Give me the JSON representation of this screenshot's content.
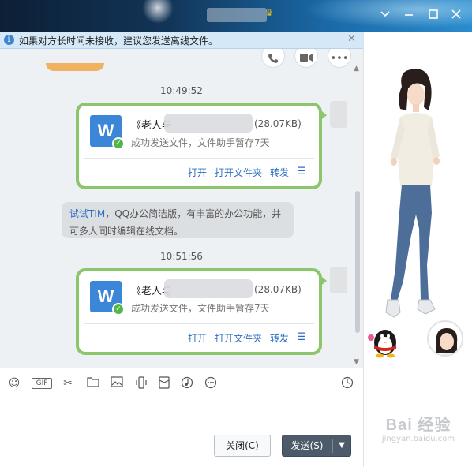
{
  "window": {
    "minimize_icon": "chevron-down-icon",
    "title_badge": "♛",
    "controls": [
      "minimize",
      "restore",
      "maximize",
      "close"
    ]
  },
  "notice": {
    "text": "如果对方长时间未接收，建议您发送离线文件。"
  },
  "chat": {
    "messages": [
      {
        "time": "10:49:52",
        "file_name": "《老人与",
        "file_size": "(28.07KB)",
        "status": "成功发送文件，文件助手暂存7天",
        "actions": [
          "打开",
          "打开文件夹",
          "转发"
        ]
      },
      {
        "time": "10:51:56",
        "file_name": "《老人与",
        "file_size": "(28.07KB)",
        "status": "成功发送文件，文件助手暂存7天",
        "actions": [
          "打开",
          "打开文件夹",
          "转发"
        ]
      }
    ],
    "tip": {
      "link": "试试TIM",
      "text": "，QQ办公简洁版，有丰富的办公功能，并可多人同时编辑在线文档。"
    }
  },
  "toolbar": {
    "gif_label": "GIF",
    "tools": [
      "emoji-icon",
      "gif-icon",
      "screenshot-icon",
      "folder-icon",
      "image-icon",
      "shake-icon",
      "red-packet-icon",
      "music-icon",
      "more-icon",
      "history-icon"
    ]
  },
  "buttons": {
    "close_label": "关闭(C)",
    "send_label": "发送(S)"
  },
  "watermark": {
    "logo": "Bai 经验",
    "url": "jingyan.baidu.com"
  },
  "colors": {
    "accent_blue": "#2d6fc2",
    "bubble_border": "#8cc56b",
    "send_button": "#4c5a6a",
    "notice_bg": "#d5e8f8"
  }
}
